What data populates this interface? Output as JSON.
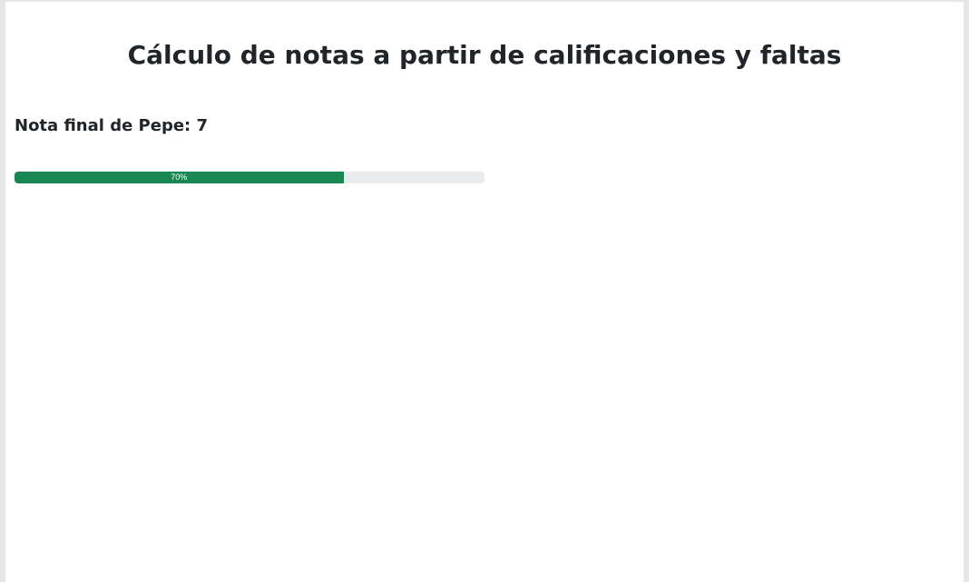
{
  "page": {
    "title": "Cálculo de notas a partir de calificaciones y faltas"
  },
  "result": {
    "label": "Nota final de Pepe:",
    "grade": "7",
    "progress_percent": 70,
    "progress_label": "70%",
    "bar_color": "#198754",
    "track_color": "#e9ecef"
  }
}
